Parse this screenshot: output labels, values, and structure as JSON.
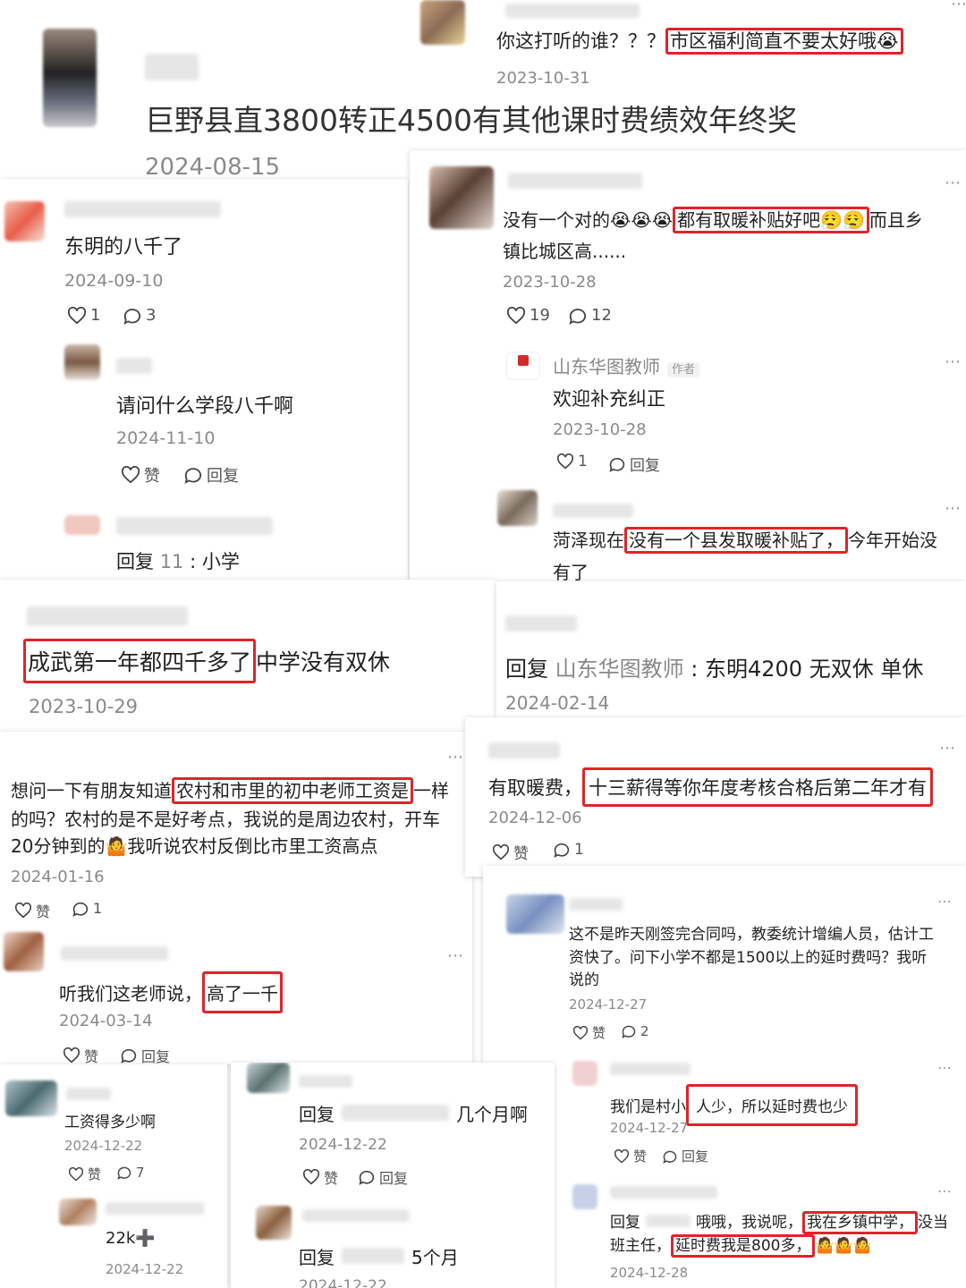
{
  "cards": {
    "c1": {
      "text_pre": "你这打听的谁？？？",
      "text_hl": "市区福利简直不要太好哦",
      "emoji": "😭",
      "date": "2023-10-31"
    },
    "c2": {
      "text": "巨野县直3800转正4500有其他课时费绩效年终奖",
      "date": "2024-08-15"
    },
    "c3": {
      "text": "东明的八千了",
      "date": "2024-09-10",
      "likes": "1",
      "comments": "3",
      "reply_text": "请问什么学段八千啊",
      "reply_date": "2024-11-10",
      "like_label": "赞",
      "reply_label": "回复",
      "reply2_pre": "回复",
      "reply2_name": "11",
      "reply2_text": "小学"
    },
    "c4": {
      "text_pre": "没有一个对的",
      "emoji1": "😭😭😭",
      "text_hl": "都有取暖补贴好吧",
      "emoji2": "😮‍💨😮‍💨",
      "text_post": "而且乡",
      "text_line2": "镇比城区高......",
      "date": "2023-10-28",
      "likes": "19",
      "comments": "12",
      "author_name": "山东华图教师",
      "author_tag": "作者",
      "author_text": "欢迎补充纠正",
      "author_date": "2023-10-28",
      "author_likes": "1",
      "reply_label": "回复",
      "r2_pre": "菏泽现在",
      "r2_hl": "没有一个县发取暖补贴了，",
      "r2_post": "今年开始没",
      "r2_line2": "有了"
    },
    "c5": {
      "text_hl": "成武第一年都四千多了",
      "text_post": "中学没有双休",
      "date": "2023-10-29"
    },
    "c6": {
      "reply_pre": "回复",
      "reply_name": "山东华图教师",
      "reply_text": "东明4200 无双休 单休",
      "date": "2024-02-14"
    },
    "c7": {
      "line1_pre": "想问一下有朋友知道",
      "line1_hl": "农村和市里的初中老师工资是",
      "line1_post": "一样",
      "line2": "的吗？农村的是不是好考点，我说的是周边农村，开车",
      "line3": "20分钟到的🤷我听说农村反倒比市里工资高点",
      "date": "2024-01-16",
      "like_label": "赞",
      "comments": "1",
      "reply_pre": "听我们这老师说，",
      "reply_hl": "高了一千",
      "reply_date": "2024-03-14",
      "reply_label": "回复"
    },
    "c8": {
      "text_pre": "有取暖费，",
      "text_hl": "十三薪得等你年度考核合格后第二年才有",
      "date": "2024-12-06",
      "like_label": "赞",
      "comments": "1"
    },
    "c9": {
      "line1": "这不是昨天刚签完合同吗，教委统计增编人员，估计工",
      "line2": "资快了。问下小学不都是1500以上的延时费吗？我听",
      "line3": "说的",
      "date": "2024-12-27",
      "like_label": "赞",
      "comments": "2",
      "r1_pre": "我们是村小",
      "r1_hl": "人少，所以延时费也少",
      "r1_date": "2024-12-27",
      "reply_label": "回复",
      "r2_pre": "回复",
      "r2_mid": "哦哦，我说呢，",
      "r2_hl1": "我在乡镇中学，",
      "r2_post": "没当",
      "r2_line2_pre": "班主任，",
      "r2_hl2": "延时费我是800多，",
      "r2_emoji": "🤷🤷🤷",
      "r2_date": "2024-12-28"
    },
    "c10": {
      "text": "工资得多少啊",
      "date": "2024-12-22",
      "like_label": "赞",
      "comments": "7",
      "reply_text": "22k➕",
      "reply_date": "2024-12-22"
    },
    "c11": {
      "reply_pre": "回复",
      "reply_post": "几个月啊",
      "date": "2024-12-22",
      "like_label": "赞",
      "reply_label": "回复",
      "r2_pre": "回复",
      "r2_post": "5个月",
      "r2_date": "2024-12-22"
    }
  },
  "colors": {
    "highlight_border": "#e0242a",
    "date_gray": "#8a8a8a"
  },
  "icons": {
    "like": "heart-icon",
    "comment": "speech-bubble-icon",
    "more": "more-dots-icon"
  }
}
